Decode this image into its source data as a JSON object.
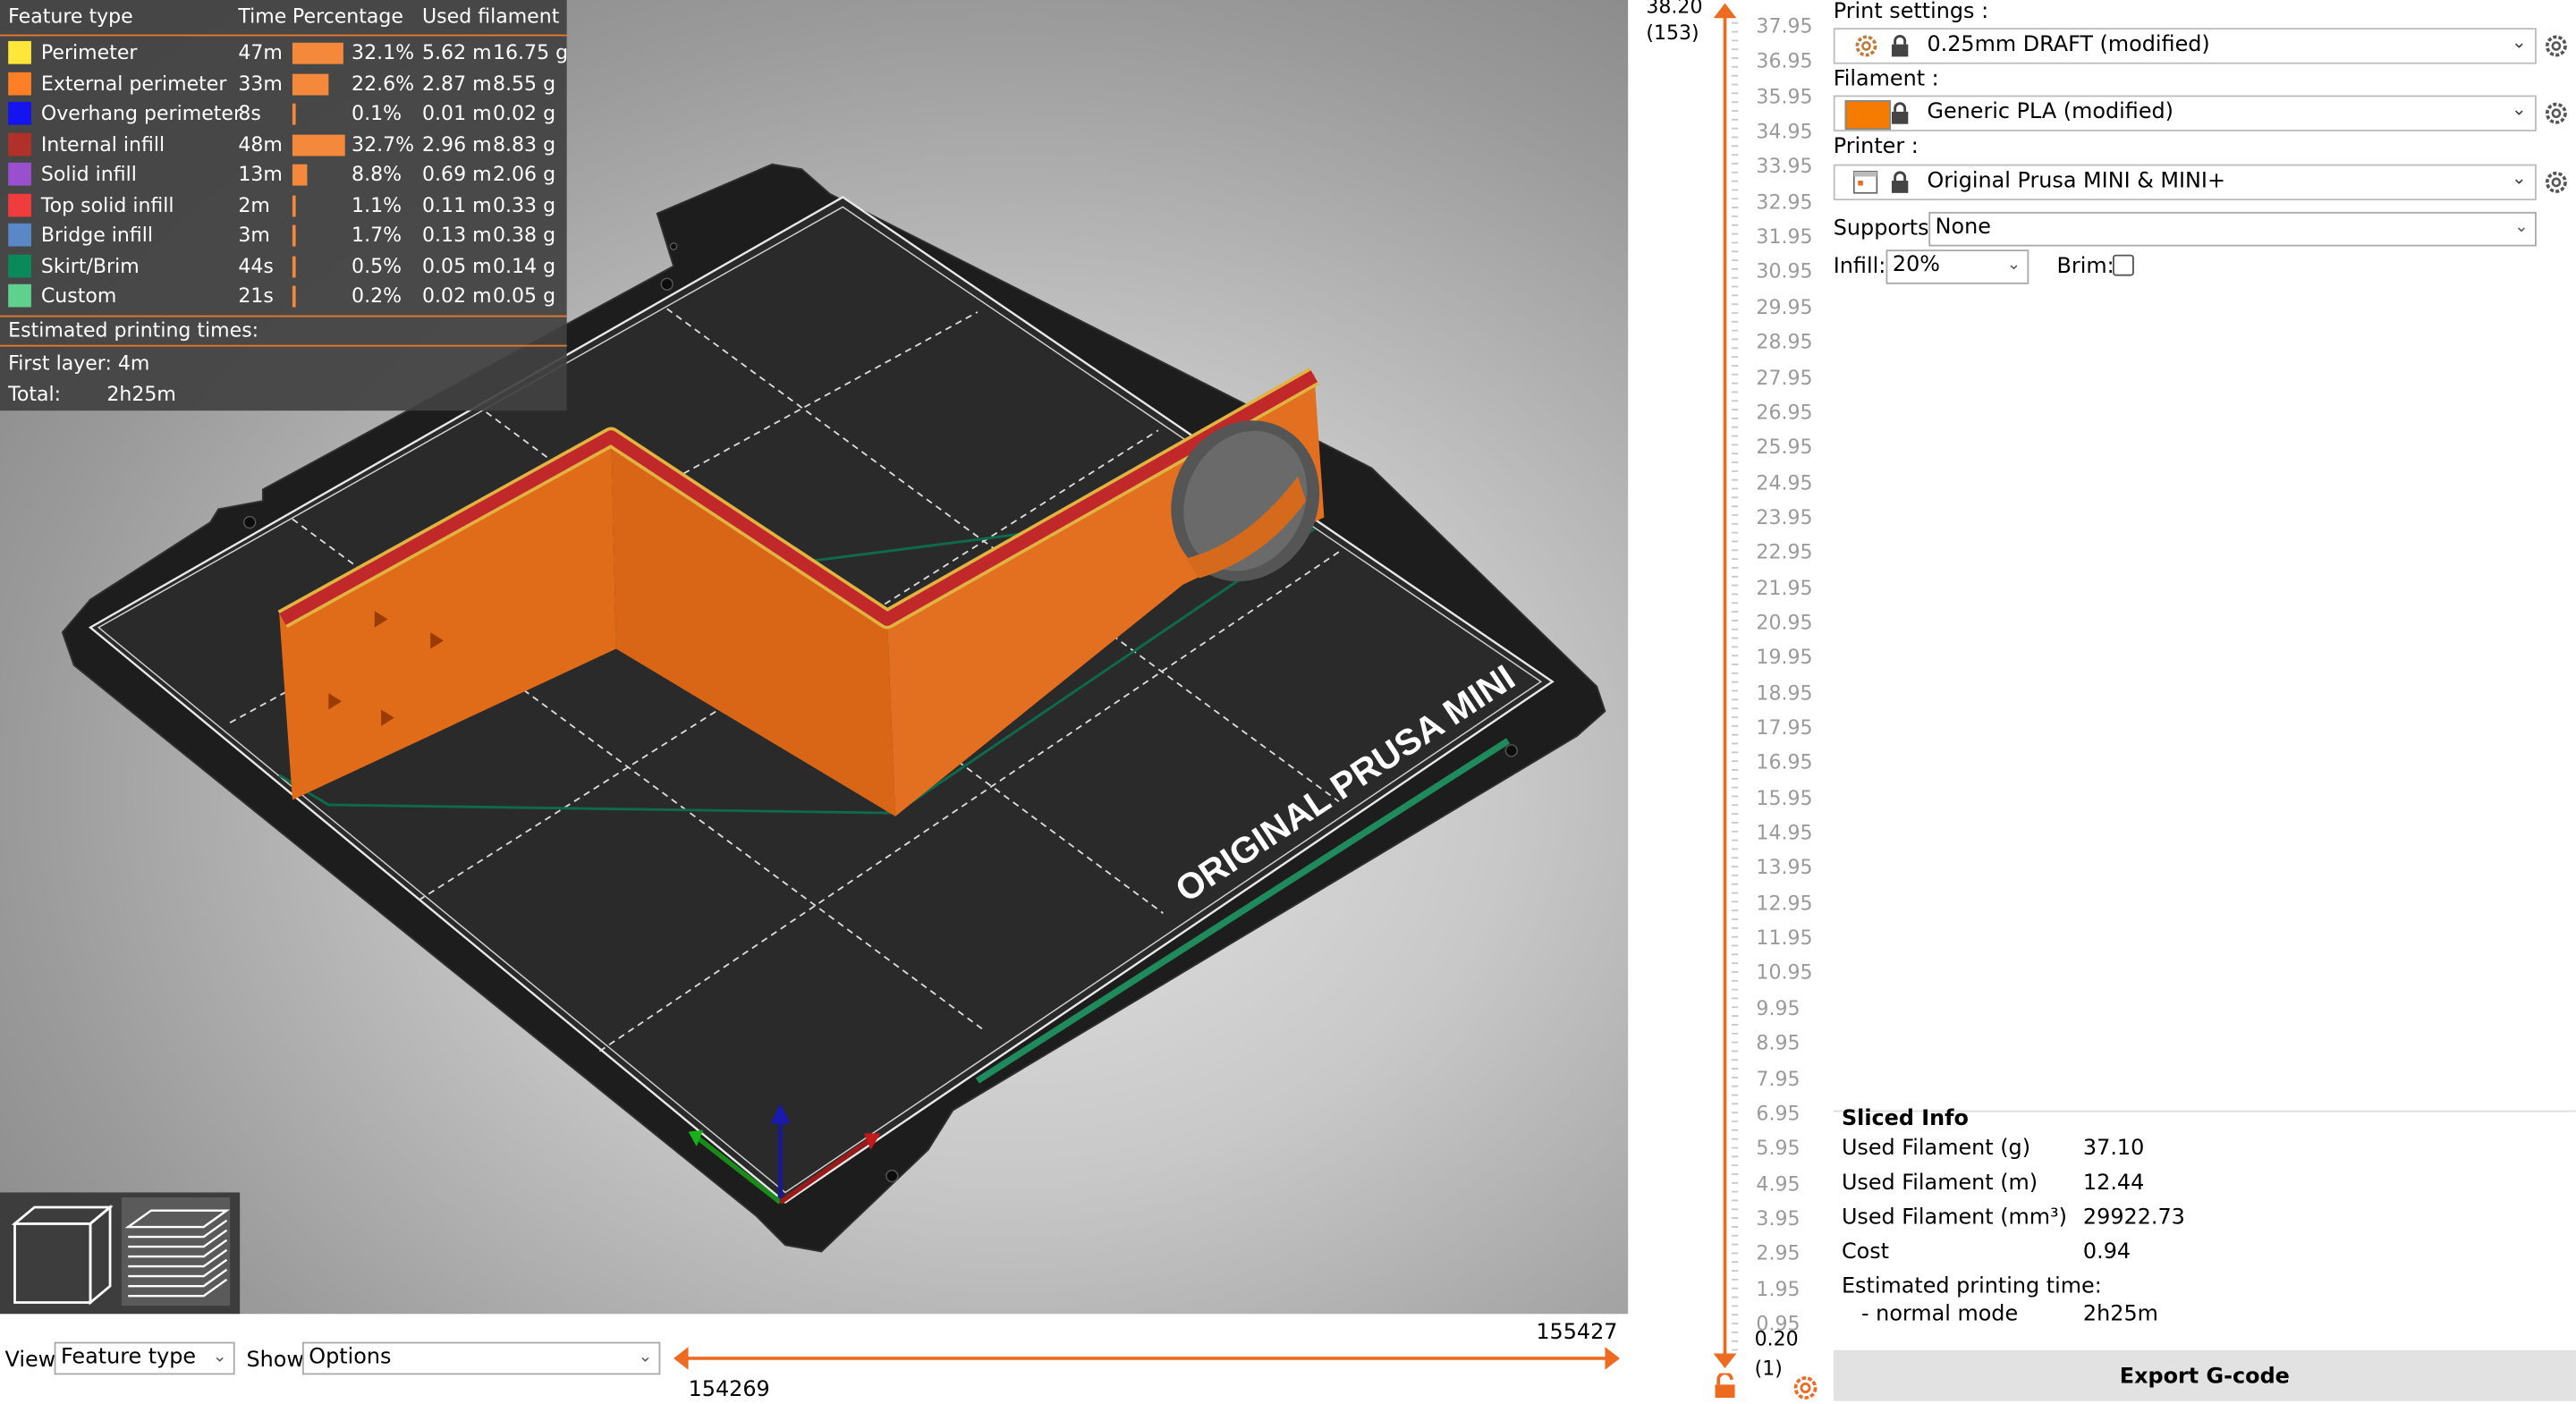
{
  "legend": {
    "headers": {
      "feature": "Feature type",
      "time": "Time",
      "percentage": "Percentage",
      "used": "Used filament"
    },
    "rows": [
      {
        "name": "Perimeter",
        "color": "#ffe63a",
        "time": "47m",
        "pct": "32.1%",
        "pct_value": 32.1,
        "m": "5.62 m",
        "g": "16.75 g"
      },
      {
        "name": "External perimeter",
        "color": "#ff7f27",
        "time": "33m",
        "pct": "22.6%",
        "pct_value": 22.6,
        "m": "2.87 m",
        "g": "8.55 g"
      },
      {
        "name": "Overhang perimeter",
        "color": "#1414f0",
        "time": "8s",
        "pct": "0.1%",
        "pct_value": 0.1,
        "m": "0.01 m",
        "g": "0.02 g"
      },
      {
        "name": "Internal infill",
        "color": "#b2302a",
        "time": "48m",
        "pct": "32.7%",
        "pct_value": 32.7,
        "m": "2.96 m",
        "g": "8.83 g"
      },
      {
        "name": "Solid infill",
        "color": "#9a4fcf",
        "time": "13m",
        "pct": "8.8%",
        "pct_value": 8.8,
        "m": "0.69 m",
        "g": "2.06 g"
      },
      {
        "name": "Top solid infill",
        "color": "#f03c3c",
        "time": "2m",
        "pct": "1.1%",
        "pct_value": 1.1,
        "m": "0.11 m",
        "g": "0.33 g"
      },
      {
        "name": "Bridge infill",
        "color": "#5a88c6",
        "time": "3m",
        "pct": "1.7%",
        "pct_value": 1.7,
        "m": "0.13 m",
        "g": "0.38 g"
      },
      {
        "name": "Skirt/Brim",
        "color": "#0a8a5a",
        "time": "44s",
        "pct": "0.5%",
        "pct_value": 0.5,
        "m": "0.05 m",
        "g": "0.14 g"
      },
      {
        "name": "Custom",
        "color": "#5fd08d",
        "time": "21s",
        "pct": "0.2%",
        "pct_value": 0.2,
        "m": "0.02 m",
        "g": "0.05 g"
      }
    ],
    "estimated_title": "Estimated printing times:",
    "first_layer": "First layer: 4m",
    "total_label": "Total:",
    "total_value": "2h25m"
  },
  "bed_label": "ORIGINAL PRUSA MINI",
  "bottom": {
    "view_label": "View",
    "view_value": "Feature type",
    "show_label": "Show",
    "show_value": "Options",
    "move_start": "154269",
    "move_end": "155427"
  },
  "layers": {
    "top_value": "38.20",
    "top_index": "(153)",
    "bottom_value": "0.20",
    "bottom_index": "(1)",
    "ticks": [
      "37.95",
      "36.95",
      "35.95",
      "34.95",
      "33.95",
      "32.95",
      "31.95",
      "30.95",
      "29.95",
      "28.95",
      "27.95",
      "26.95",
      "25.95",
      "24.95",
      "23.95",
      "22.95",
      "21.95",
      "20.95",
      "19.95",
      "18.95",
      "17.95",
      "16.95",
      "15.95",
      "14.95",
      "13.95",
      "12.95",
      "11.95",
      "10.95",
      "9.95",
      "8.95",
      "7.95",
      "6.95",
      "5.95",
      "4.95",
      "3.95",
      "2.95",
      "1.95",
      "0.95"
    ]
  },
  "settings": {
    "print_label": "Print settings :",
    "print_value": "0.25mm DRAFT (modified)",
    "filament_label": "Filament :",
    "filament_value": "Generic PLA (modified)",
    "filament_color": "#f57c00",
    "printer_label": "Printer :",
    "printer_value": "Original Prusa MINI & MINI+",
    "supports_label": "Supports:",
    "supports_value": "None",
    "infill_label": "Infill:",
    "infill_value": "20%",
    "brim_label": "Brim:",
    "brim_checked": false
  },
  "sliced_info": {
    "title": "Sliced Info",
    "rows": [
      {
        "label": "Used Filament (g)",
        "value": "37.10"
      },
      {
        "label": "Used Filament (m)",
        "value": "12.44"
      },
      {
        "label": "Used Filament (mm³)",
        "value": "29922.73"
      },
      {
        "label": "Cost",
        "value": "0.94"
      }
    ],
    "est_label": "Estimated printing time:",
    "mode_label": "- normal mode",
    "mode_value": "2h25m"
  },
  "export_label": "Export G-code",
  "accent": "#ed6b21"
}
